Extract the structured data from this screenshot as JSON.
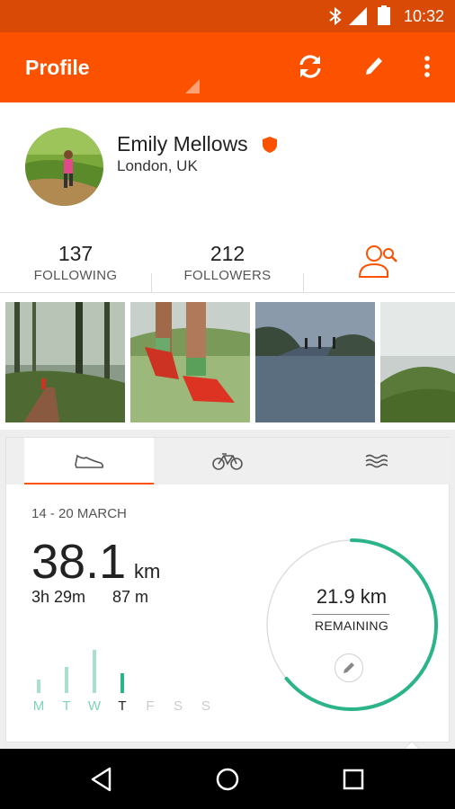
{
  "status_bar": {
    "time": "10:32"
  },
  "app_bar": {
    "title": "Profile"
  },
  "profile": {
    "name": "Emily Mellows",
    "location": "London, UK"
  },
  "stats": {
    "following": {
      "count": "137",
      "label": "FOLLOWING"
    },
    "followers": {
      "count": "212",
      "label": "FOLLOWERS"
    }
  },
  "activity": {
    "tabs": [
      {
        "icon": "shoe-icon"
      },
      {
        "icon": "bike-icon"
      },
      {
        "icon": "swim-icon"
      }
    ],
    "selected_tab": 0,
    "week_range": "14 - 20 MARCH",
    "distance_value": "38.1",
    "distance_unit": "km",
    "time": "3h 29m",
    "elevation": "87 m",
    "daily_levels": [
      0.22,
      0.42,
      0.68,
      0.32,
      0,
      0,
      0
    ],
    "days": [
      "M",
      "T",
      "W",
      "T",
      "F",
      "S",
      "S"
    ],
    "today_index": 3,
    "goal_progress": 0.64,
    "remaining_value": "21.9 km",
    "remaining_label": "REMAINING"
  },
  "colors": {
    "status_bar": "#d94a07",
    "brand": "#fc5200",
    "goal_ring": "#2bb38a",
    "bar_past": "#a8e0cd",
    "bar_today": "#2bb38a"
  }
}
